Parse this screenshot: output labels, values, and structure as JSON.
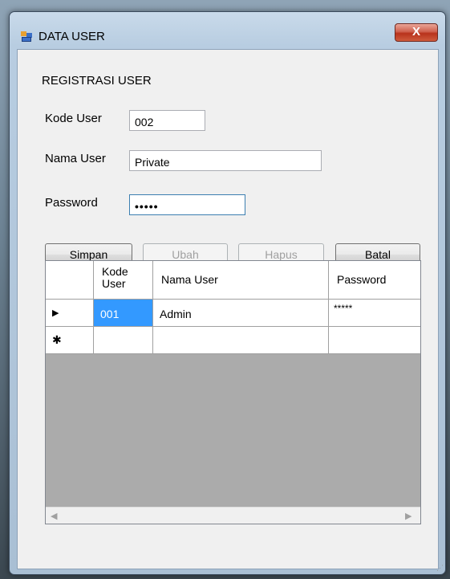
{
  "window": {
    "title": "DATA USER",
    "close_label": "X"
  },
  "form": {
    "heading": "REGISTRASI USER",
    "kode_user": {
      "label": "Kode User",
      "value": "002"
    },
    "nama_user": {
      "label": "Nama User",
      "value": "Private"
    },
    "password": {
      "label": "Password",
      "value": "•••••"
    }
  },
  "buttons": {
    "simpan": "Simpan",
    "ubah": "Ubah",
    "hapus": "Hapus",
    "batal": "Batal"
  },
  "grid": {
    "columns": [
      "Kode User",
      "Nama User",
      "Password"
    ],
    "rows": [
      {
        "marker": "▶",
        "kode": "001",
        "nama": "Admin",
        "password": "*****"
      }
    ],
    "new_row_marker": "✱"
  },
  "scroll": {
    "left": "◀",
    "right": "▶"
  }
}
